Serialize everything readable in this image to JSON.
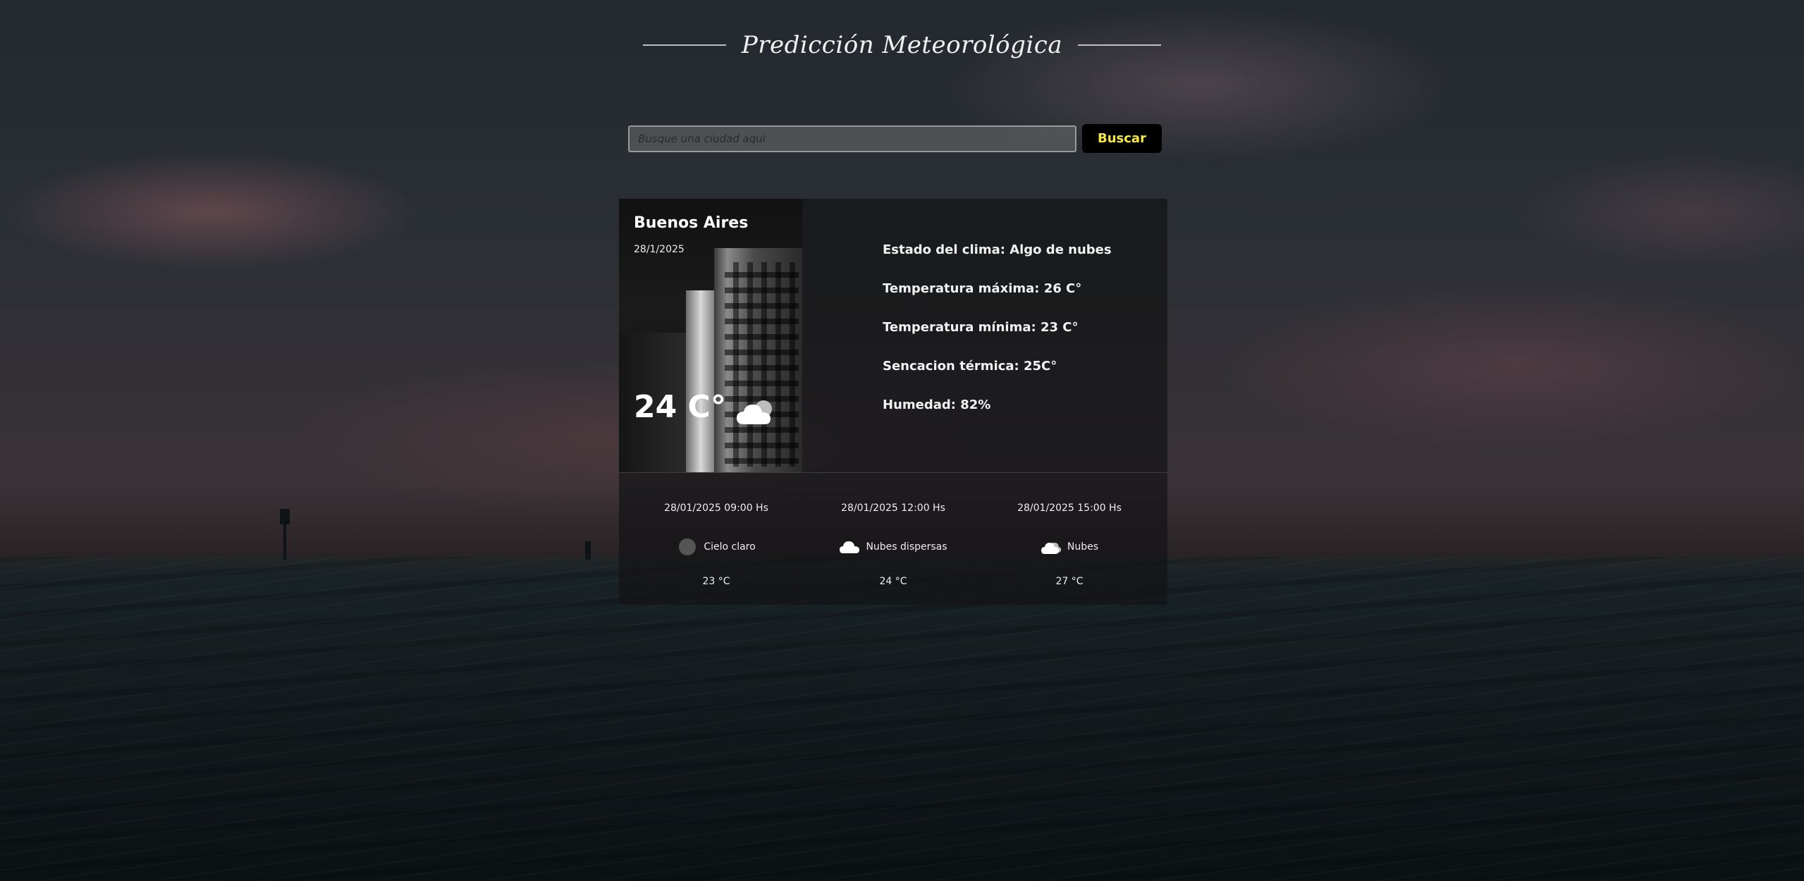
{
  "header": {
    "title": "Predicción Meteorológica"
  },
  "search": {
    "placeholder": "Busque una ciudad aqui",
    "button_label": "Buscar"
  },
  "current": {
    "city": "Buenos Aires",
    "date": "28/1/2025",
    "temperature": "24 C°",
    "icon": "cloud-icon",
    "details": [
      "Estado del clima: Algo de nubes",
      "Temperatura máxima: 26 C°",
      "Temperatura mínima: 23 C°",
      "Sencacion térmica: 25C°",
      "Humedad: 82%"
    ]
  },
  "forecast": [
    {
      "time": "28/01/2025 09:00 Hs",
      "icon": "clear-sky-icon",
      "description": "Cielo claro",
      "temp": "23 °C"
    },
    {
      "time": "28/01/2025 12:00 Hs",
      "icon": "scattered-clouds-icon",
      "description": "Nubes dispersas",
      "temp": "24 °C"
    },
    {
      "time": "28/01/2025 15:00 Hs",
      "icon": "clouds-icon",
      "description": "Nubes",
      "temp": "27 °C"
    }
  ],
  "colors": {
    "button_text": "#f6e94a",
    "button_bg": "#000000"
  }
}
